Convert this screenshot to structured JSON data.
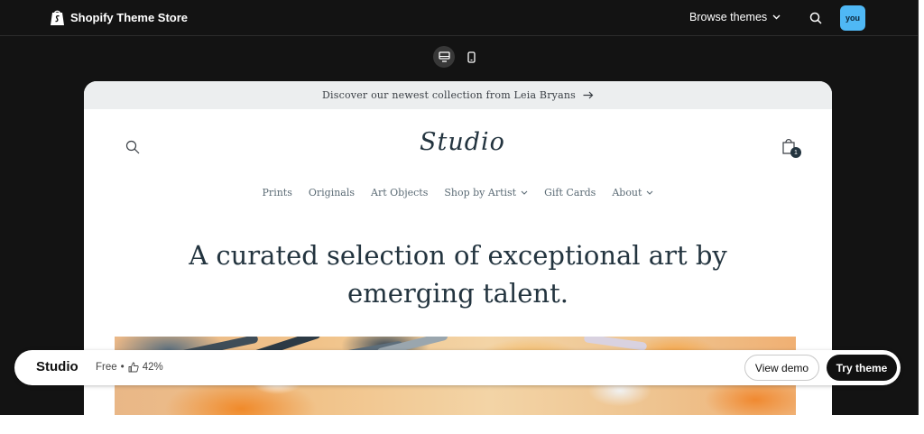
{
  "topbar": {
    "logo_text": "Shopify Theme Store",
    "browse_label": "Browse themes",
    "avatar_text": "you"
  },
  "device_toggle": {
    "options": [
      "desktop",
      "mobile"
    ],
    "selected": "desktop"
  },
  "preview": {
    "announcement": "Discover our newest collection from Leia Bryans",
    "logo_text": "Studio",
    "cart_count": "1",
    "nav": [
      {
        "label": "Prints",
        "has_dropdown": false
      },
      {
        "label": "Originals",
        "has_dropdown": false
      },
      {
        "label": "Art Objects",
        "has_dropdown": false
      },
      {
        "label": "Shop by Artist",
        "has_dropdown": true
      },
      {
        "label": "Gift Cards",
        "has_dropdown": false
      },
      {
        "label": "About",
        "has_dropdown": true
      }
    ],
    "headline_line1": "A curated selection of exceptional art by",
    "headline_line2": "emerging talent."
  },
  "bottombar": {
    "theme_name": "Studio",
    "price": "Free",
    "separator": "•",
    "rating": "42%",
    "view_demo_label": "View demo",
    "try_theme_label": "Try theme"
  },
  "colors": {
    "app_background": "#131313",
    "avatar": "#4fb8f5",
    "text_dark": "#23343f",
    "announcement_bg": "#eceeef"
  }
}
